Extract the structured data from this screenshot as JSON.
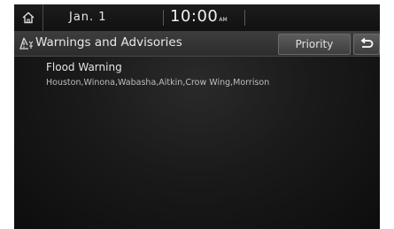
{
  "status": {
    "date": "Jan.  1",
    "time": "10:00",
    "ampm": "AM",
    "home_icon": "home-icon"
  },
  "header": {
    "title": "Warnings and Advisories",
    "warning_icon": "warning-triangle-icon",
    "priority_label": "Priority",
    "back_icon": "back-arrow-icon"
  },
  "alerts": [
    {
      "title": "Flood Warning",
      "areas": "Houston,Winona,Wabasha,Aitkin,Crow Wing,Morrison"
    }
  ]
}
